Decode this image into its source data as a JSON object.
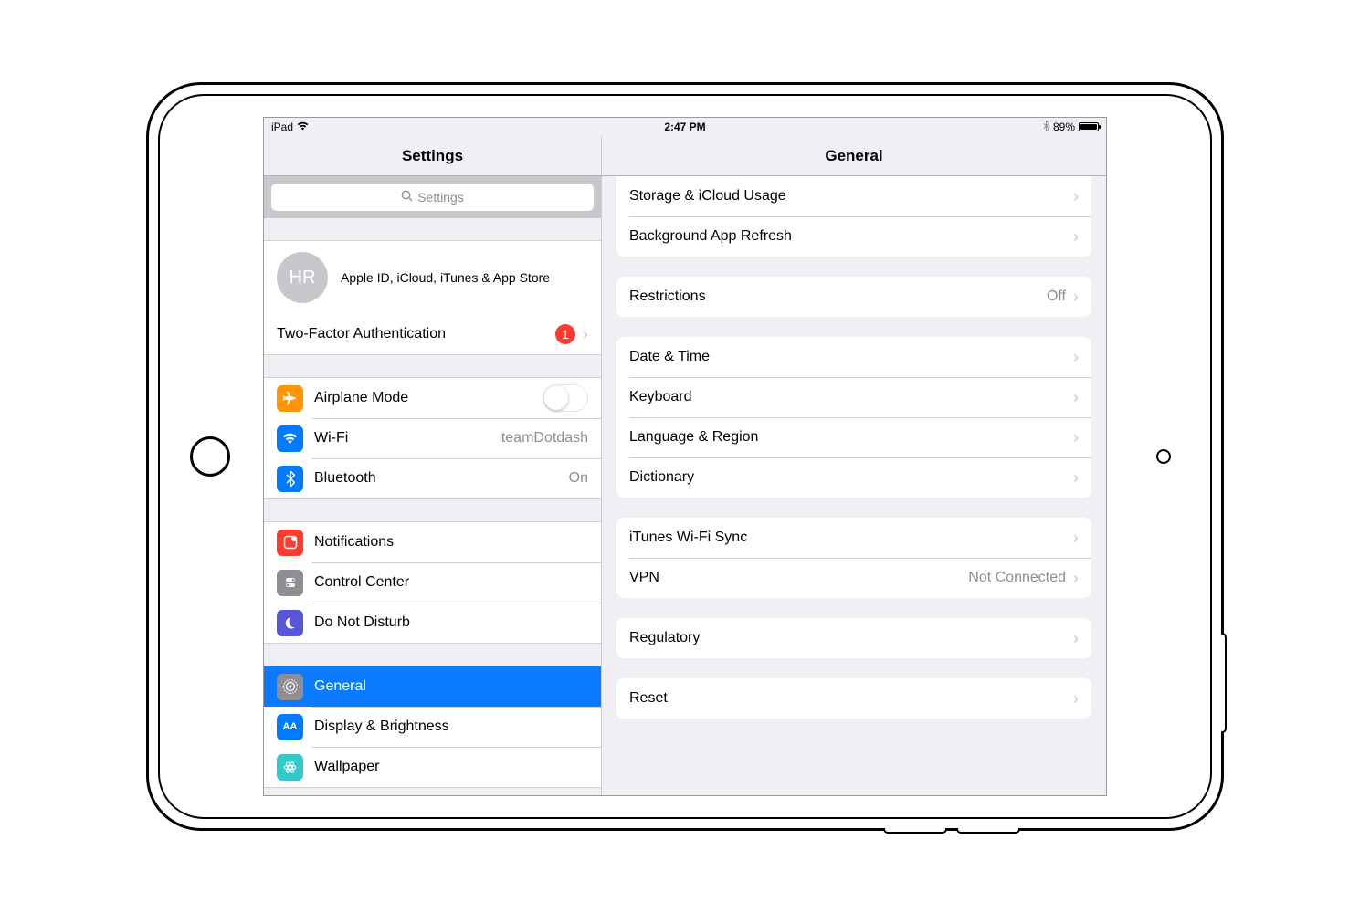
{
  "status": {
    "device": "iPad",
    "time": "2:47 PM",
    "battery": "89%"
  },
  "nav": {
    "left": "Settings",
    "right": "General"
  },
  "search": {
    "placeholder": "Settings"
  },
  "appleid": {
    "initials": "HR",
    "subtitle": "Apple ID, iCloud, iTunes & App Store"
  },
  "twofa": {
    "label": "Two-Factor Authentication",
    "badge": "1"
  },
  "sidebar": {
    "airplane": "Airplane Mode",
    "wifi": "Wi-Fi",
    "wifi_value": "teamDotdash",
    "bluetooth": "Bluetooth",
    "bluetooth_value": "On",
    "notifications": "Notifications",
    "control_center": "Control Center",
    "dnd": "Do Not Disturb",
    "general": "General",
    "display": "Display & Brightness",
    "wallpaper": "Wallpaper"
  },
  "detail": {
    "storage": "Storage & iCloud Usage",
    "bgrefresh": "Background App Refresh",
    "restrictions": "Restrictions",
    "restrictions_value": "Off",
    "datetime": "Date & Time",
    "keyboard": "Keyboard",
    "language": "Language & Region",
    "dictionary": "Dictionary",
    "itunes_sync": "iTunes Wi-Fi Sync",
    "vpn": "VPN",
    "vpn_value": "Not Connected",
    "regulatory": "Regulatory",
    "reset": "Reset"
  }
}
